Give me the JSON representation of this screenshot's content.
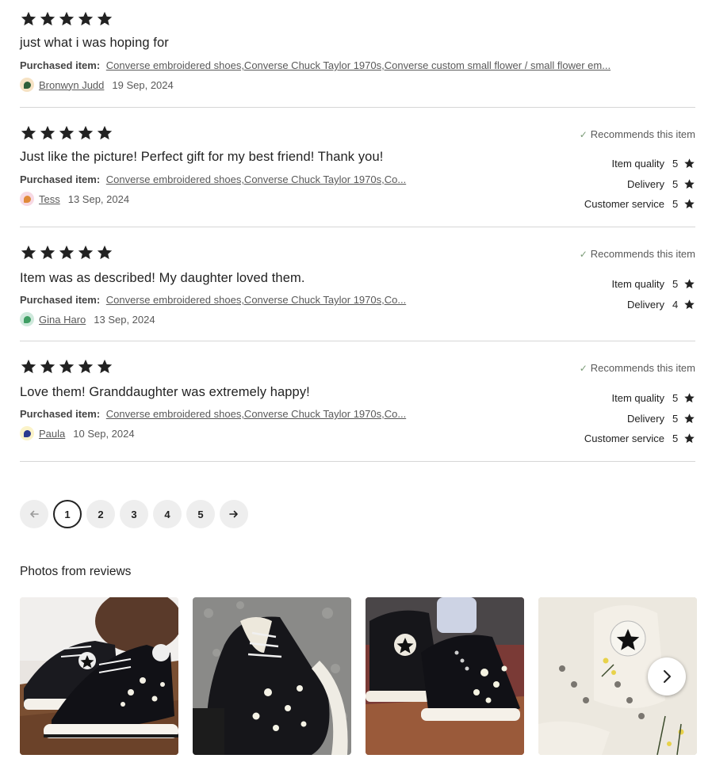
{
  "reviews": [
    {
      "rating": 5,
      "text": "just what i was hoping for",
      "purchased_label": "Purchased item:",
      "purchased_item": "Converse embroidered shoes,Converse Chuck Taylor 1970s,Converse custom small flower / small flower em...",
      "reviewer": "Bronwyn Judd",
      "date": "19 Sep, 2024",
      "avatar_color": "#f6e2c4",
      "avatar_dot": "#2e5f3a"
    },
    {
      "rating": 5,
      "text": "Just like the picture! Perfect gift for my best friend! Thank you!",
      "purchased_label": "Purchased item:",
      "purchased_item": "Converse embroidered shoes,Converse Chuck Taylor 1970s,Co...",
      "reviewer": "Tess",
      "date": "13 Sep, 2024",
      "avatar_color": "#f7d9e4",
      "avatar_dot": "#e08a3a",
      "recommends": "Recommends this item",
      "ratings": [
        {
          "label": "Item quality",
          "value": "5"
        },
        {
          "label": "Delivery",
          "value": "5"
        },
        {
          "label": "Customer service",
          "value": "5"
        }
      ]
    },
    {
      "rating": 5,
      "text": "Item was as described! My daughter loved them.",
      "purchased_label": "Purchased item:",
      "purchased_item": "Converse embroidered shoes,Converse Chuck Taylor 1970s,Co...",
      "reviewer": "Gina Haro",
      "date": "13 Sep, 2024",
      "avatar_color": "#cfe9dc",
      "avatar_dot": "#3f9e63",
      "recommends": "Recommends this item",
      "ratings": [
        {
          "label": "Item quality",
          "value": "5"
        },
        {
          "label": "Delivery",
          "value": "4"
        }
      ]
    },
    {
      "rating": 5,
      "text": "Love them! Granddaughter was extremely happy!",
      "purchased_label": "Purchased item:",
      "purchased_item": "Converse embroidered shoes,Converse Chuck Taylor 1970s,Co...",
      "reviewer": "Paula",
      "date": "10 Sep, 2024",
      "avatar_color": "#fbf3c9",
      "avatar_dot": "#2b3a8f",
      "recommends": "Recommends this item",
      "ratings": [
        {
          "label": "Item quality",
          "value": "5"
        },
        {
          "label": "Delivery",
          "value": "5"
        },
        {
          "label": "Customer service",
          "value": "5"
        }
      ]
    }
  ],
  "pagination": {
    "prev_icon": "arrow-left-icon",
    "pages": [
      "1",
      "2",
      "3",
      "4",
      "5"
    ],
    "current": "1",
    "next_icon": "arrow-right-icon"
  },
  "photos_section": {
    "title": "Photos from reviews",
    "photos": [
      {
        "subject": "black embroidered high-top sneakers on wooden floor"
      },
      {
        "subject": "close-up of black sneaker with white flower embroidery"
      },
      {
        "subject": "black high-tops with flowers on carpet"
      },
      {
        "subject": "white high-tops with flower embroidery"
      }
    ],
    "next_icon": "chevron-right-icon"
  }
}
